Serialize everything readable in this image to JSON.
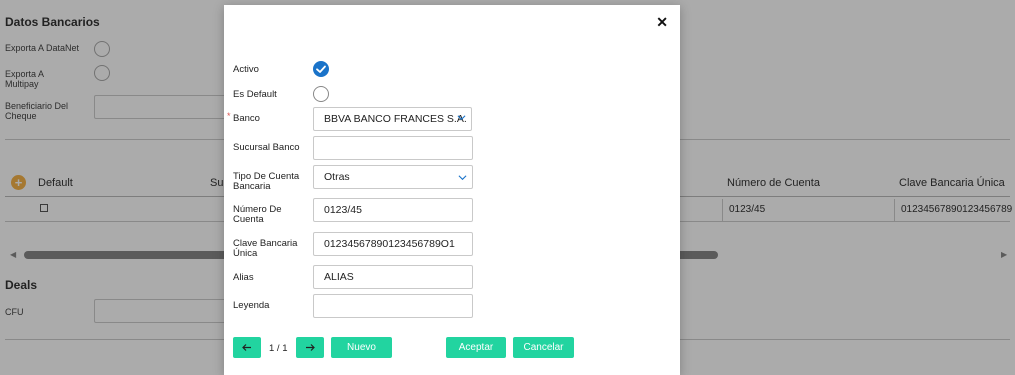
{
  "background": {
    "datos_bancarios_title": "Datos Bancarios",
    "exporta_datanet_label": "Exporta A DataNet",
    "exporta_multipay_label": "Exporta A Multipay",
    "beneficiario_label": "Beneficiario Del Cheque",
    "table": {
      "headers": [
        "Default",
        "Su",
        "Número de Cuenta",
        "Clave Bancaria Única"
      ],
      "row": {
        "numero_cuenta": "0123/45",
        "clave_bancaria": "01234567890123456789"
      }
    },
    "deals_title": "Deals",
    "cfu_label": "CFU"
  },
  "modal": {
    "close_glyph": "✕",
    "fields": {
      "activo_label": "Activo",
      "es_default_label": "Es Default",
      "banco_label": "Banco",
      "banco_required": "*",
      "banco_value": "BBVA BANCO FRANCES S.A.",
      "sucursal_label": "Sucursal Banco",
      "sucursal_value": "",
      "tipo_cuenta_label": "Tipo De Cuenta Bancaria",
      "tipo_cuenta_value": "Otras",
      "numero_cuenta_label": "Número De Cuenta",
      "numero_cuenta_value": "0123/45",
      "clave_label": "Clave Bancaria Única",
      "clave_value": "01234567890123456789O1",
      "alias_label": "Alias",
      "alias_value": "ALIAS",
      "leyenda_label": "Leyenda",
      "leyenda_value": ""
    },
    "activo_checked": true,
    "es_default_checked": false,
    "footer": {
      "prev_icon": "←",
      "pager_text": "1 / 1",
      "next_icon": "→",
      "nuevo_label": "Nuevo",
      "aceptar_label": "Aceptar",
      "cancelar_label": "Cancelar"
    }
  },
  "colors": {
    "accent_button": "#22d4a0",
    "checkbox_on": "#1a73c9",
    "required": "#d9534f",
    "overlay": "rgba(0,0,0,0.33)"
  }
}
